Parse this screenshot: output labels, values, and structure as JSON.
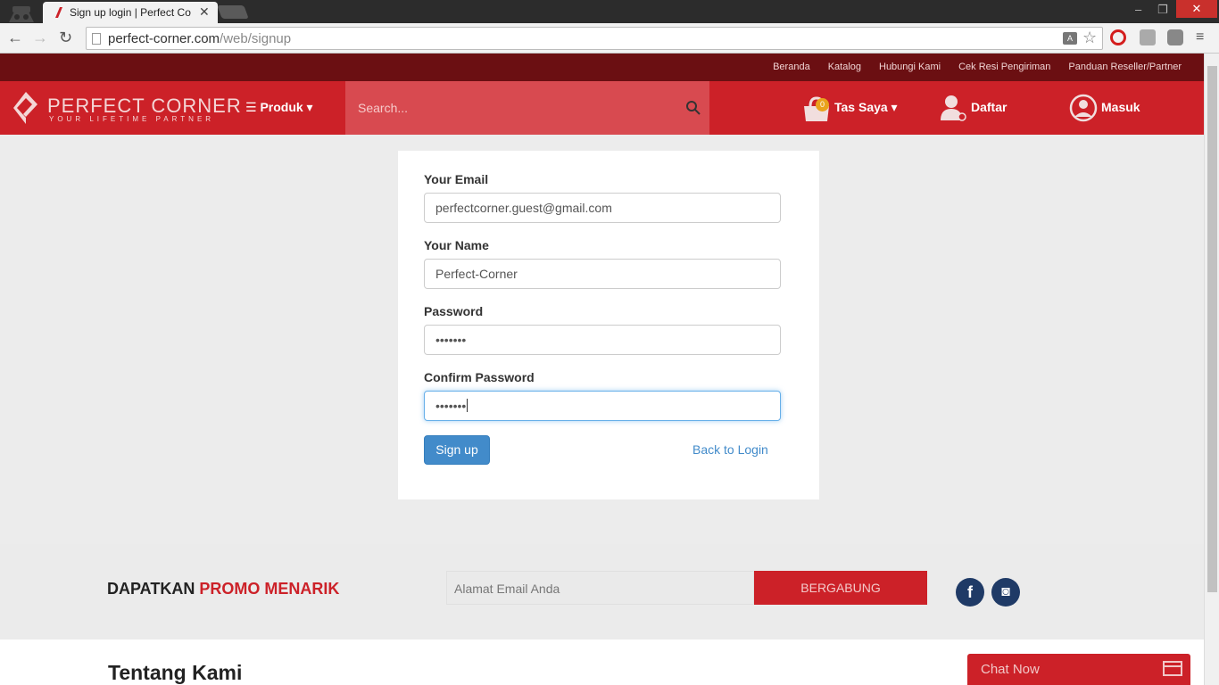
{
  "browser": {
    "tab_title": "Sign up login | Perfect Co",
    "tab_close": "✕",
    "url_host": "perfect-corner.com",
    "url_path": "/web/signup",
    "minimize": "–",
    "restore": "❐",
    "close": "✕",
    "back": "←",
    "forward": "→",
    "reload": "↻",
    "star": "☆",
    "menu": "≡"
  },
  "site": {
    "top_links": [
      "Beranda",
      "Katalog",
      "Hubungi Kami",
      "Cek Resi Pengiriman",
      "Panduan Reseller/Partner"
    ],
    "brand": "PERFECT CORNER",
    "tagline": "YOUR LIFETIME PARTNER",
    "produk": "☰ Produk ▾",
    "search_placeholder": "Search...",
    "cart_count": "0",
    "cart_label": "Tas Saya ▾",
    "register": "Daftar",
    "login": "Masuk",
    "accent": "#cc2128"
  },
  "form": {
    "email_label": "Your Email",
    "email_value": "perfectcorner.guest@gmail.com",
    "name_label": "Your Name",
    "name_value": "Perfect-Corner",
    "password_label": "Password",
    "password_value": "•••••••",
    "confirm_label": "Confirm Password",
    "confirm_value": "•••••••",
    "signup_button": "Sign up",
    "back_link": "Back to Login"
  },
  "footer": {
    "promo_prefix": "DAPATKAN ",
    "promo_highlight": "PROMO MENARIK",
    "email_placeholder": "Alamat Email Anda",
    "join_button": "BERGABUNG",
    "facebook": "f",
    "instagram": "◙",
    "about_title": "Tentang Kami",
    "chat": "Chat Now"
  }
}
